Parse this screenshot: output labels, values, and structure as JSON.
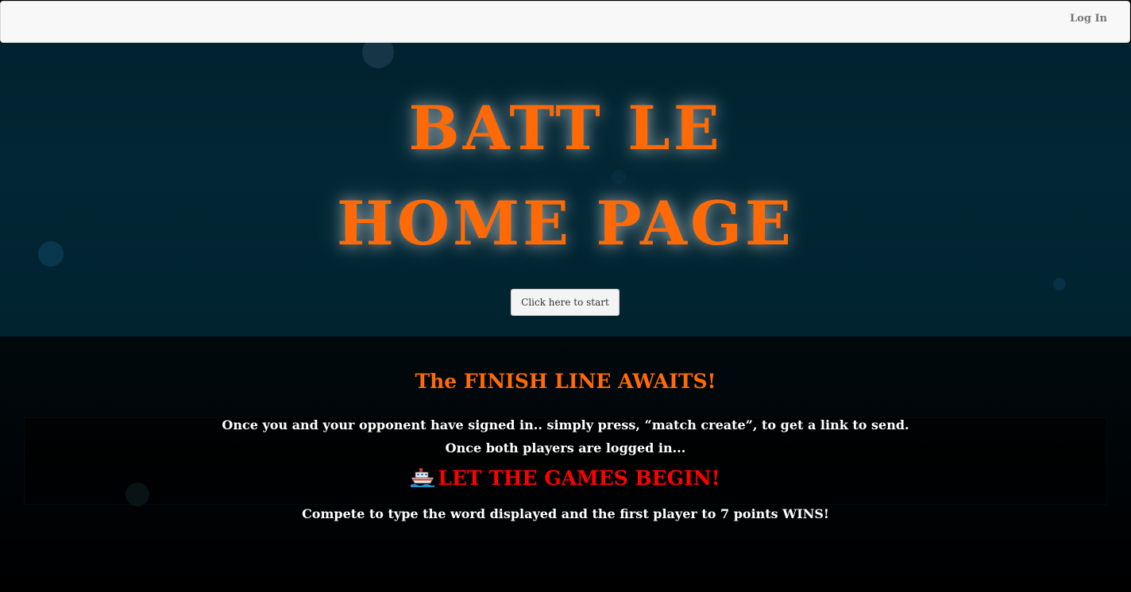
{
  "navbar": {
    "login_label": "Log In"
  },
  "hero": {
    "title_line1": "BATT LE",
    "title_line2": "HOME PAGE",
    "start_button": "Click here to start"
  },
  "info": {
    "heading": "The FINISH LINE AWAITS!",
    "line1": "Once you and your opponent have signed in.. simply press, “match create”, to get a link to send.",
    "line2": "Once both players are logged in...",
    "begin_icon": "ship-icon",
    "begin": "LET THE GAMES BEGIN!",
    "line3": "Compete to type the word displayed and the first player to 7 points WINS!"
  },
  "colors": {
    "accent_orange": "#ff6a07",
    "begin_red": "#ff0000",
    "hero_bg": "#022634"
  }
}
